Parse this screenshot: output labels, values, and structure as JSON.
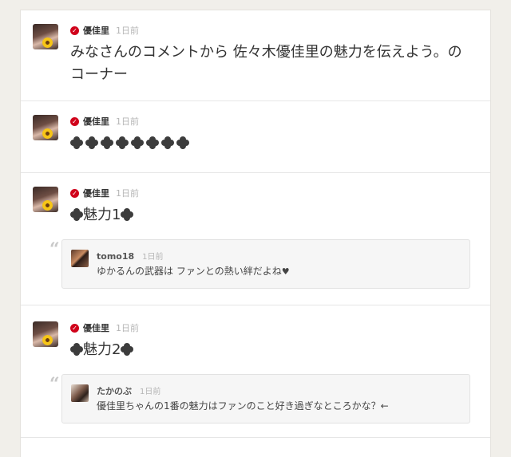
{
  "posts": [
    {
      "author": "優佳里",
      "time": "1日前",
      "text": "みなさんのコメントから 佐々木優佳里の魅力を伝えよう。のコーナー"
    },
    {
      "author": "優佳里",
      "time": "1日前",
      "clover_count": 8
    },
    {
      "author": "優佳里",
      "time": "1日前",
      "text": "魅力1",
      "reply": {
        "author": "tomo18",
        "time": "1日前",
        "text": "ゆかるんの武器は ファンとの熱い絆だよね"
      }
    },
    {
      "author": "優佳里",
      "time": "1日前",
      "text": "魅力2",
      "reply": {
        "author": "たかのぶ",
        "time": "1日前",
        "text": "優佳里ちゃんの1番の魅力はファンのこと好き過ぎなところかな？←"
      }
    }
  ],
  "icons": {
    "verified": "check-badge-icon",
    "clover": "clover-icon",
    "quote": "quote-icon",
    "heart": "heart-icon"
  },
  "colors": {
    "verified": "#d0021b",
    "background": "#f1efea",
    "card": "#ffffff"
  }
}
